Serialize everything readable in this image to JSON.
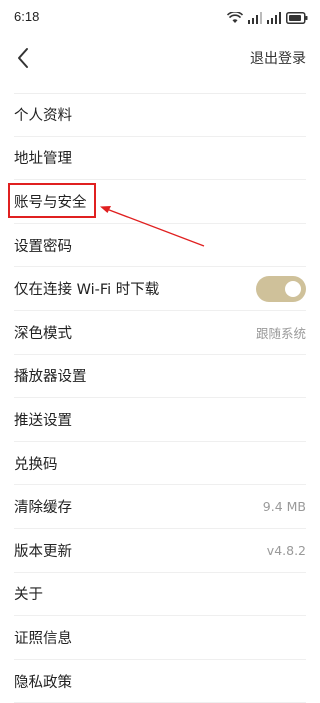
{
  "status_bar": {
    "time": "6:18"
  },
  "nav": {
    "logout_label": "退出登录"
  },
  "settings": [
    {
      "label": "个人资料",
      "value": ""
    },
    {
      "label": "地址管理",
      "value": ""
    },
    {
      "label": "账号与安全",
      "value": ""
    },
    {
      "label": "设置密码",
      "value": ""
    },
    {
      "label": "仅在连接 Wi-Fi 时下载",
      "value": "",
      "toggle_on": true
    },
    {
      "label": "深色模式",
      "value": "跟随系统"
    },
    {
      "label": "播放器设置",
      "value": ""
    },
    {
      "label": "推送设置",
      "value": ""
    },
    {
      "label": "兑换码",
      "value": ""
    },
    {
      "label": "清除缓存",
      "value": "9.4 MB"
    },
    {
      "label": "版本更新",
      "value": "v4.8.2"
    },
    {
      "label": "关于",
      "value": ""
    },
    {
      "label": "证照信息",
      "value": ""
    },
    {
      "label": "隐私政策",
      "value": ""
    }
  ],
  "colors": {
    "toggle_on": "#cfc19a",
    "annotation": "#e02020"
  },
  "icons": [
    "wifi-icon",
    "signal-icon",
    "battery-icon",
    "back-icon"
  ]
}
